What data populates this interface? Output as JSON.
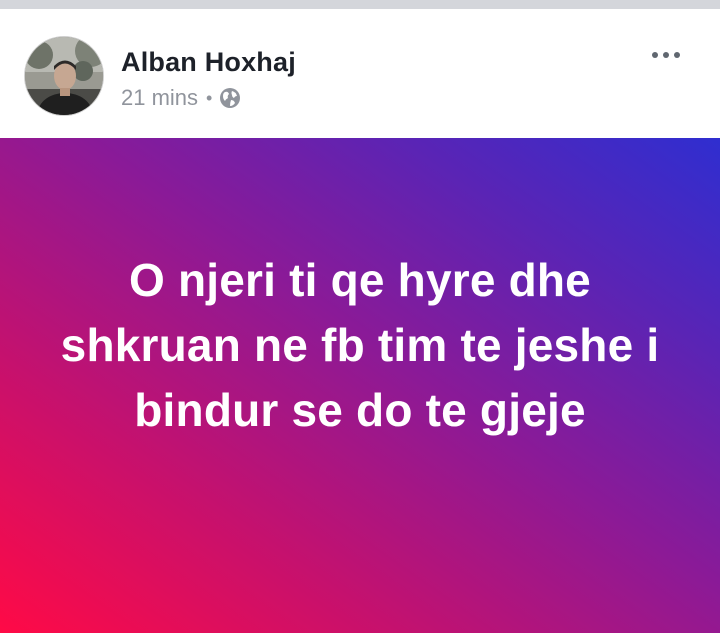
{
  "post": {
    "author": "Alban Hoxhaj",
    "time": "21 mins",
    "separator": "•",
    "privacy_icon": "globe-icon",
    "more_icon": "more-options-icon",
    "text": "O njeri ti qe hyre dhe shkruan ne fb tim te jeshe i bindur se do te gjeje",
    "background_gradient": [
      "#ff0a46",
      "#c5116e",
      "#8b1a97",
      "#5a24b5",
      "#2f2ed0"
    ],
    "text_color": "#ffffff"
  },
  "colors": {
    "name": "#1d2129",
    "meta": "#90949c",
    "divider": "#d4d6db"
  }
}
